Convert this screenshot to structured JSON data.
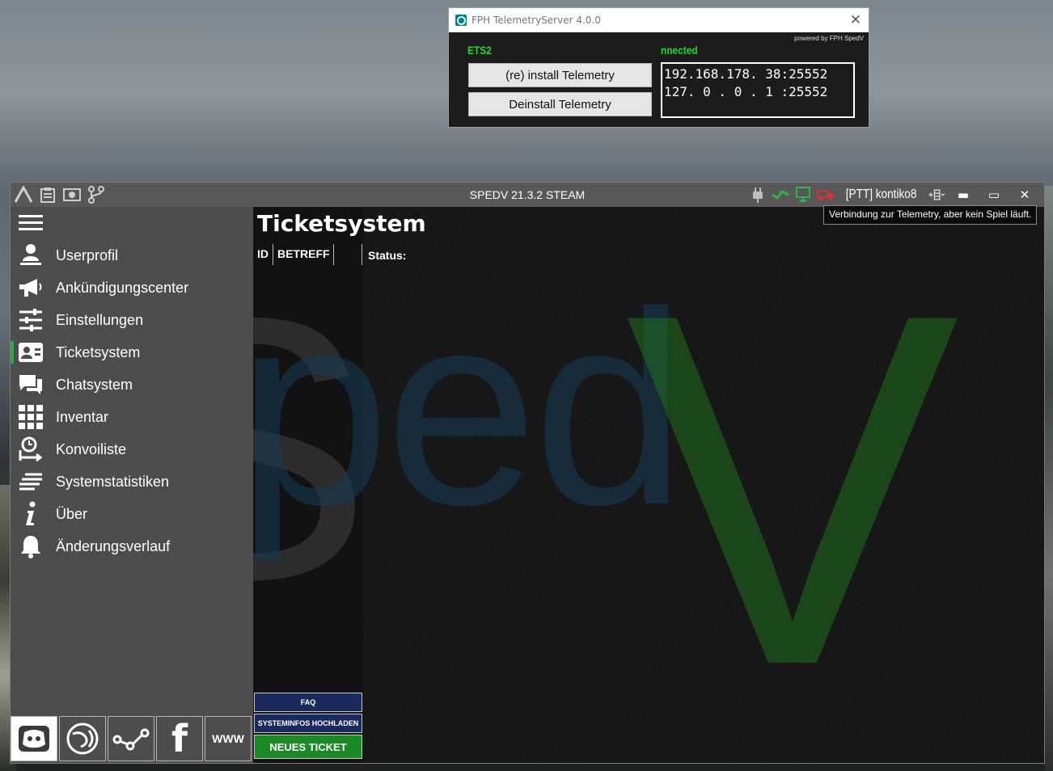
{
  "telemetry": {
    "window_title": "FPH TelemetryServer 4.0.0",
    "close": "✕",
    "powered_by": "powered by FPH SpedV",
    "game": "ETS2",
    "status": "nnected",
    "install_label": "(re) install Telemetry",
    "deinstall_label": "Deinstall Telemetry",
    "ip_lines": "192.168.178. 38:25552\n127. 0 . 0 . 1 :25552"
  },
  "app": {
    "title": "SPEDV 21.3.2 STEAM",
    "user": "[PTT] kontiko8",
    "tooltip": "Verbindung zur Telemetry, aber kein Spiel läuft.",
    "status_colors": {
      "plug": "#bdbdbd",
      "telemetry": "#2fb34a",
      "pc": "#2fb34a",
      "truck": "#e03030"
    },
    "window_controls": {
      "minimize": "▬",
      "maximize": "▭",
      "close": "✕"
    }
  },
  "sidebar": {
    "items": [
      {
        "label": "Userprofil",
        "icon": "user-icon"
      },
      {
        "label": "Ankündigungscenter",
        "icon": "megaphone-icon"
      },
      {
        "label": "Einstellungen",
        "icon": "sliders-icon"
      },
      {
        "label": "Ticketsystem",
        "icon": "ticket-icon",
        "active": true
      },
      {
        "label": "Chatsystem",
        "icon": "chat-icon"
      },
      {
        "label": "Inventar",
        "icon": "grid-icon"
      },
      {
        "label": "Konvoiliste",
        "icon": "convoy-icon"
      },
      {
        "label": "Systemstatistiken",
        "icon": "stats-icon"
      },
      {
        "label": "Über",
        "icon": "info-icon"
      },
      {
        "label": "Änderungsverlauf",
        "icon": "bell-icon"
      }
    ],
    "social": [
      {
        "name": "discord-icon"
      },
      {
        "name": "teamspeak-icon"
      },
      {
        "name": "share-icon"
      },
      {
        "name": "facebook-icon",
        "glyph": "f"
      },
      {
        "name": "www-icon",
        "glyph": "WWW"
      }
    ]
  },
  "content": {
    "title": "Ticketsystem",
    "columns": [
      "ID",
      "BETREFF",
      ""
    ],
    "status_label": "Status:",
    "watermark": {
      "s": "S",
      "ped": "ped",
      "v": "V"
    },
    "buttons": {
      "faq": "FAQ",
      "sysinfo": "SYSTEMINFOS HOCHLADEN",
      "new_ticket": "NEUES TICKET"
    }
  }
}
